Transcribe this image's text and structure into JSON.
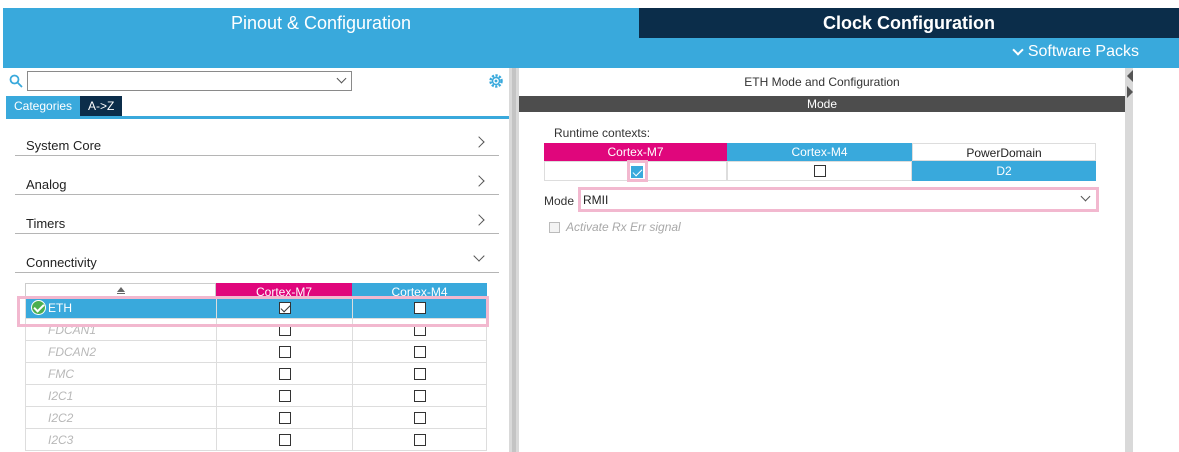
{
  "tabs": {
    "pinout": "Pinout & Configuration",
    "clock": "Clock Configuration",
    "software_packs": "Software Packs"
  },
  "left": {
    "search_value": "",
    "category_tabs": [
      "Categories",
      "A->Z"
    ],
    "categories": [
      {
        "label": "System Core",
        "expanded": false
      },
      {
        "label": "Analog",
        "expanded": false
      },
      {
        "label": "Timers",
        "expanded": false
      },
      {
        "label": "Connectivity",
        "expanded": true
      }
    ],
    "table_headers": {
      "m7": "Cortex-M7",
      "m4": "Cortex-M4"
    },
    "peripherals": [
      {
        "name": "ETH",
        "m7": true,
        "m4": false,
        "selected": true
      },
      {
        "name": "FDCAN1",
        "m7": false,
        "m4": false,
        "selected": false
      },
      {
        "name": "FDCAN2",
        "m7": false,
        "m4": false,
        "selected": false
      },
      {
        "name": "FMC",
        "m7": false,
        "m4": false,
        "selected": false
      },
      {
        "name": "I2C1",
        "m7": false,
        "m4": false,
        "selected": false
      },
      {
        "name": "I2C2",
        "m7": false,
        "m4": false,
        "selected": false
      },
      {
        "name": "I2C3",
        "m7": false,
        "m4": false,
        "selected": false
      }
    ]
  },
  "right": {
    "title": "ETH Mode and Configuration",
    "mode_bar": "Mode",
    "runtime_label": "Runtime contexts:",
    "contexts": {
      "m7": "Cortex-M7",
      "m4": "Cortex-M4",
      "power": "PowerDomain",
      "power_value": "D2"
    },
    "context_checks": {
      "m7": true,
      "m4": false
    },
    "mode_label": "Mode",
    "mode_value": "RMII",
    "rx_err_label": "Activate Rx Err signal"
  },
  "colors": {
    "accent": "#39a9dc",
    "dark": "#0b2d4a",
    "m7": "#e0067c",
    "highlight": "#f2b8cf"
  }
}
